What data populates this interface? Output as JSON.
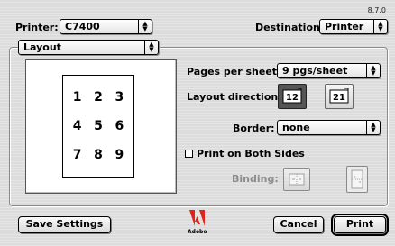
{
  "version": "8.7.0",
  "printer": {
    "label": "Printer:",
    "value": "C7400"
  },
  "destination": {
    "label": "Destination:",
    "value": "Printer"
  },
  "panel_selector": {
    "value": "Layout"
  },
  "preview": {
    "numbers": [
      "1",
      "2",
      "3",
      "4",
      "5",
      "6",
      "7",
      "8",
      "9"
    ]
  },
  "pages_per_sheet": {
    "label": "Pages per sheet:",
    "value": "9 pgs/sheet"
  },
  "layout_direction": {
    "label": "Layout direction:",
    "option1": "12",
    "option2": "21"
  },
  "border": {
    "label": "Border:",
    "value": "none"
  },
  "both_sides": {
    "label": "Print on Both Sides",
    "checked": false
  },
  "binding": {
    "label": "Binding:"
  },
  "buttons": {
    "save": "Save Settings",
    "cancel": "Cancel",
    "print": "Print"
  },
  "logo": {
    "text": "Adobe"
  }
}
